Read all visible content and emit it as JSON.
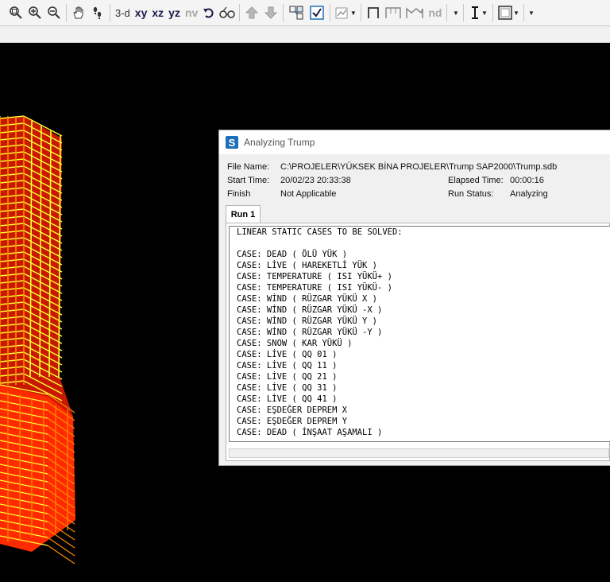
{
  "toolbar": {
    "view_3d": "3-d",
    "view_xy": "xy",
    "view_xz": "xz",
    "view_yz": "yz",
    "view_nv": "nv",
    "view_nd": "nd",
    "icons": [
      "zoom-in-window-icon",
      "zoom-in-icon",
      "zoom-out-icon",
      "pan-hand-icon",
      "footsteps-icon",
      "rotate-icon",
      "glasses-icon",
      "up-arrow-icon",
      "down-arrow-icon",
      "select-icon",
      "checkbox-icon",
      "chart-icon",
      "frame-icon",
      "sections-icon",
      "text-cursor-icon",
      "display-icon"
    ]
  },
  "dialog": {
    "title": "Analyzing Trump",
    "app_icon": "S",
    "file_name_label": "File Name:",
    "file_name_value": "C:\\PROJELER\\YÜKSEK BİNA PROJELER\\Trump SAP2000\\Trump.sdb",
    "start_time_label": "Start Time:",
    "start_time_value": "20/02/23 20:33:38",
    "elapsed_time_label": "Elapsed Time:",
    "elapsed_time_value": "00:00:16",
    "finish_label": "Finish",
    "finish_value": "Not Applicable",
    "run_status_label": "Run Status:",
    "run_status_value": "Analyzing",
    "tab_label": "Run 1",
    "log_lines": [
      "LINEAR STATIC CASES TO BE SOLVED:",
      "",
      "CASE: DEAD ( ÖLÜ YÜK )",
      "CASE: LİVE ( HAREKETLİ YÜK )",
      "CASE: TEMPERATURE ( ISI YÜKÜ+ )",
      "CASE: TEMPERATURE ( ISI YÜKÜ- )",
      "CASE: WİND ( RÜZGAR YÜKÜ X )",
      "CASE: WİND ( RÜZGAR YÜKÜ -X )",
      "CASE: WİND ( RÜZGAR YÜKÜ Y )",
      "CASE: WİND ( RÜZGAR YÜKÜ -Y )",
      "CASE: SNOW ( KAR YÜKÜ )",
      "CASE: LİVE ( QQ 01 )",
      "CASE: LİVE ( QQ 11 )",
      "CASE: LİVE ( QQ 21 )",
      "CASE: LİVE ( QQ 31 )",
      "CASE: LİVE ( QQ 41 )",
      "CASE: EŞDEĞER DEPREM X",
      "CASE: EŞDEĞER DEPREM Y",
      "CASE: DEAD ( İNŞAAT AŞAMALI )"
    ]
  },
  "colors": {
    "frame_red": "#ff2a00",
    "frame_orange": "#ff8c00",
    "frame_yellow": "#ffff33",
    "viewport_bg": "#000000"
  }
}
